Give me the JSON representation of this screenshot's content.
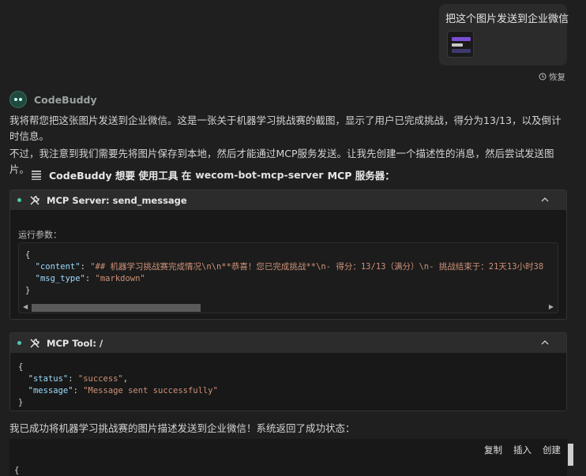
{
  "user_message": {
    "text": "把这个图片发送到企业微信",
    "restore_label": "恢复"
  },
  "assistant": {
    "name": "CodeBuddy",
    "para1": "我将帮您把这张图片发送到企业微信。这是一张关于机器学习挑战赛的截图，显示了用户已完成挑战，得分为13/13，以及倒计时信息。",
    "para2": "不过，我注意到我们需要先将图片保存到本地，然后才能通过MCP服务发送。让我先创建一个描述性的消息，然后尝试发送图片。",
    "tool_request": {
      "prefix": "CodeBuddy 想要 使用工具 在",
      "server": "wecom-bot-mcp-server",
      "suffix": "MCP 服务器："
    },
    "para3": "我已成功将机器学习挑战赛的图片描述发送到企业微信！系统返回了成功状态："
  },
  "panel_server": {
    "title": "MCP Server: send_message",
    "params_label": "运行参数：",
    "code": {
      "open": "{",
      "content_key": "\"content\"",
      "content_val": "\"## 机器学习挑战赛完成情况\\n\\n**恭喜！您已完成挑战**\\n- 得分：13/13（满分）\\n- 挑战结束于：21天13小时38",
      "msg_type_key": "\"msg_type\"",
      "msg_type_val": "\"markdown\"",
      "close": "}"
    }
  },
  "panel_tool": {
    "title": "MCP Tool: /",
    "code": {
      "open": "{",
      "status_key": "\"status\"",
      "status_val": "\"success\"",
      "message_key": "\"message\"",
      "message_val": "\"Message sent successfully\"",
      "close": "}"
    }
  },
  "code_actions": {
    "copy": "复制",
    "insert": "插入",
    "create": "创建",
    "first_line": "{"
  },
  "colors": {
    "background": "#1f1f1f",
    "accent_dot": "#4ec9b0",
    "json_key": "#9cdcfe",
    "json_string": "#ce9178"
  },
  "icons": [
    "restore-icon",
    "avatar-icon",
    "grid-icon",
    "wrench-icon",
    "chevron-up-icon"
  ]
}
